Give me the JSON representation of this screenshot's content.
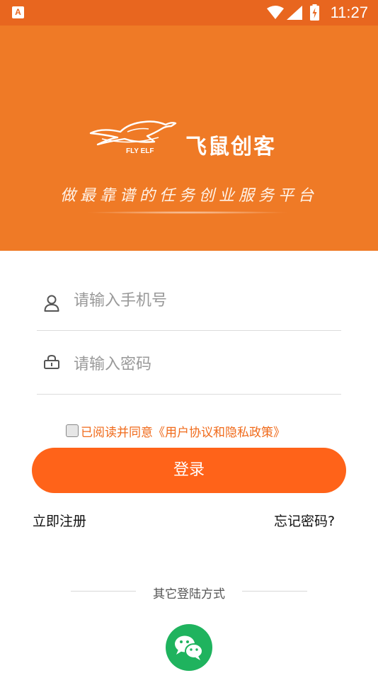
{
  "status_bar": {
    "time": "11:27",
    "app_icon_letter": "A",
    "icons": [
      "wifi-icon",
      "signal-icon",
      "battery-icon"
    ]
  },
  "banner": {
    "logo_small_text": "FLY ELF",
    "brand_name": "飞鼠创客",
    "slogan": "做最靠谱的任务创业服务平台",
    "background_color": "#ef7a26"
  },
  "form": {
    "phone_placeholder": "请输入手机号",
    "phone_value": "",
    "password_placeholder": "请输入密码",
    "password_value": "",
    "agreement_checked": false,
    "agreement_text": "已阅读并同意《用户协议和隐私政策》"
  },
  "actions": {
    "login_label": "登录",
    "register_label": "立即注册",
    "forgot_label": "忘记密码?"
  },
  "other_login": {
    "title": "其它登陆方式",
    "methods": [
      "wechat-icon"
    ]
  },
  "colors": {
    "accent": "#ff6319",
    "status_bar": "#e8661f",
    "wechat": "#1fb35e",
    "agreement_text": "#f06a1a"
  }
}
